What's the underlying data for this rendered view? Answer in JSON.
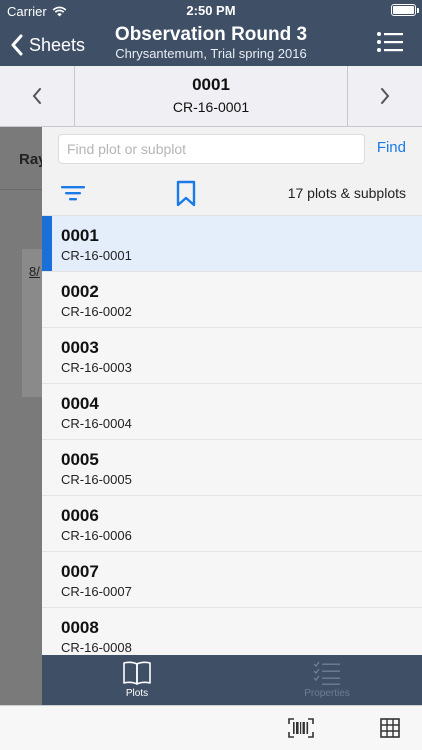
{
  "status": {
    "carrier": "Carrier",
    "time": "2:50 PM",
    "battery_level": 1.0
  },
  "nav": {
    "back_label": "Sheets",
    "title": "Observation Round 3",
    "subtitle": "Chrysantemum, Trial spring 2016"
  },
  "plot_nav": {
    "number": "0001",
    "code": "CR-16-0001"
  },
  "background": {
    "label": "Ray",
    "date": "8/"
  },
  "search": {
    "placeholder": "Find plot or subplot",
    "value": "",
    "find_label": "Find"
  },
  "toolbar": {
    "count_label": "17 plots & subplots"
  },
  "plots": [
    {
      "number": "0001",
      "code": "CR-16-0001",
      "selected": true
    },
    {
      "number": "0002",
      "code": "CR-16-0002",
      "selected": false
    },
    {
      "number": "0003",
      "code": "CR-16-0003",
      "selected": false
    },
    {
      "number": "0004",
      "code": "CR-16-0004",
      "selected": false
    },
    {
      "number": "0005",
      "code": "CR-16-0005",
      "selected": false
    },
    {
      "number": "0006",
      "code": "CR-16-0006",
      "selected": false
    },
    {
      "number": "0007",
      "code": "CR-16-0007",
      "selected": false
    },
    {
      "number": "0008",
      "code": "CR-16-0008",
      "selected": false
    }
  ],
  "tabs": [
    {
      "label": "Plots",
      "icon": "book-icon",
      "active": true
    },
    {
      "label": "Properties",
      "icon": "checklist-icon",
      "active": false
    }
  ],
  "colors": {
    "nav_bar": "#3e4f66",
    "accent": "#1a7ae8",
    "selection_bar": "#1a6fd8",
    "selected_row": "#e4eefb",
    "dim_overlay": "#7a7a7a"
  },
  "icons": {
    "back": "chevron-left-icon",
    "menu": "list-menu-icon",
    "prev": "chevron-left-icon",
    "next": "chevron-right-icon",
    "filter": "filter-icon",
    "bookmark": "bookmark-icon",
    "barcode": "barcode-scan-icon",
    "grid": "grid-icon",
    "wifi": "wifi-icon",
    "battery": "battery-icon"
  }
}
